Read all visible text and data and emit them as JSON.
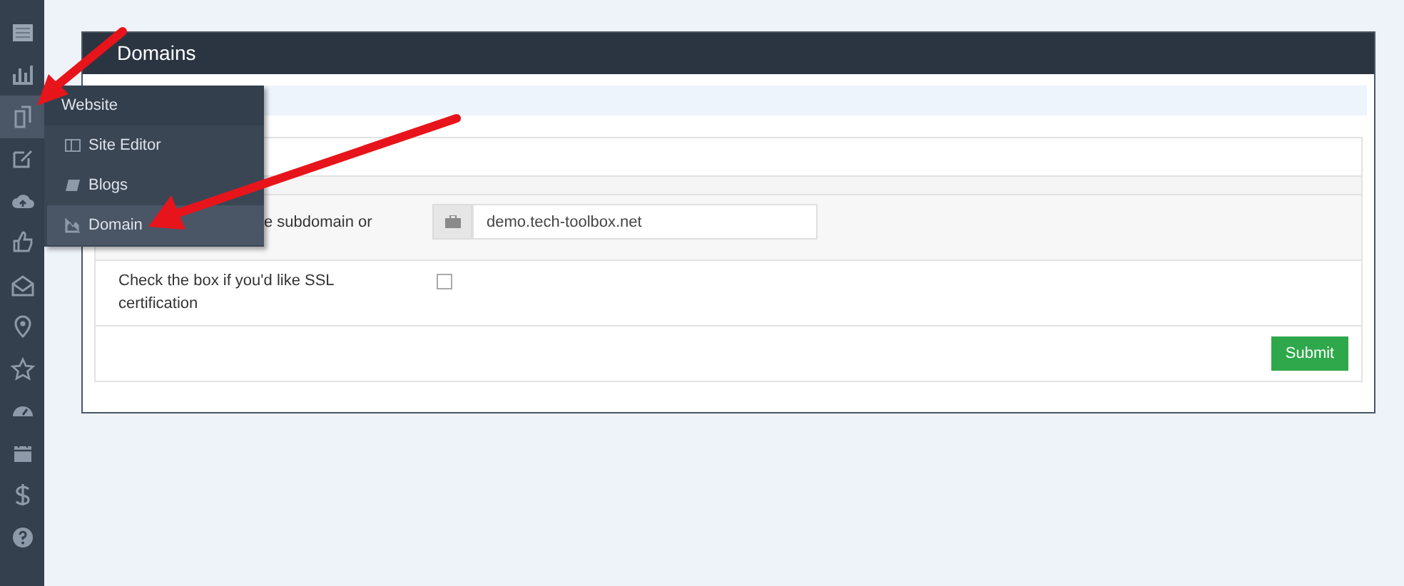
{
  "sidebar": {
    "items": [
      {
        "selected": false
      },
      {
        "selected": false
      },
      {
        "selected": true
      },
      {
        "selected": false
      },
      {
        "selected": false
      },
      {
        "selected": false
      },
      {
        "selected": false
      },
      {
        "selected": false
      },
      {
        "selected": false
      },
      {
        "selected": false
      },
      {
        "selected": false
      },
      {
        "selected": false
      },
      {
        "selected": false
      }
    ]
  },
  "flyout": {
    "title": "Website",
    "items": [
      {
        "label": "Site Editor",
        "selected": false
      },
      {
        "label": "Blogs",
        "selected": false
      },
      {
        "label": "Domain",
        "selected": true
      }
    ]
  },
  "panel": {
    "title": "Domains",
    "rows": [
      {
        "kind": "text",
        "label": "e subdomain or",
        "value": "demo.tech-toolbox.net"
      },
      {
        "kind": "checkbox",
        "label": "Check the box if you'd like SSL certification",
        "checked": false
      }
    ],
    "submit": "Submit"
  }
}
